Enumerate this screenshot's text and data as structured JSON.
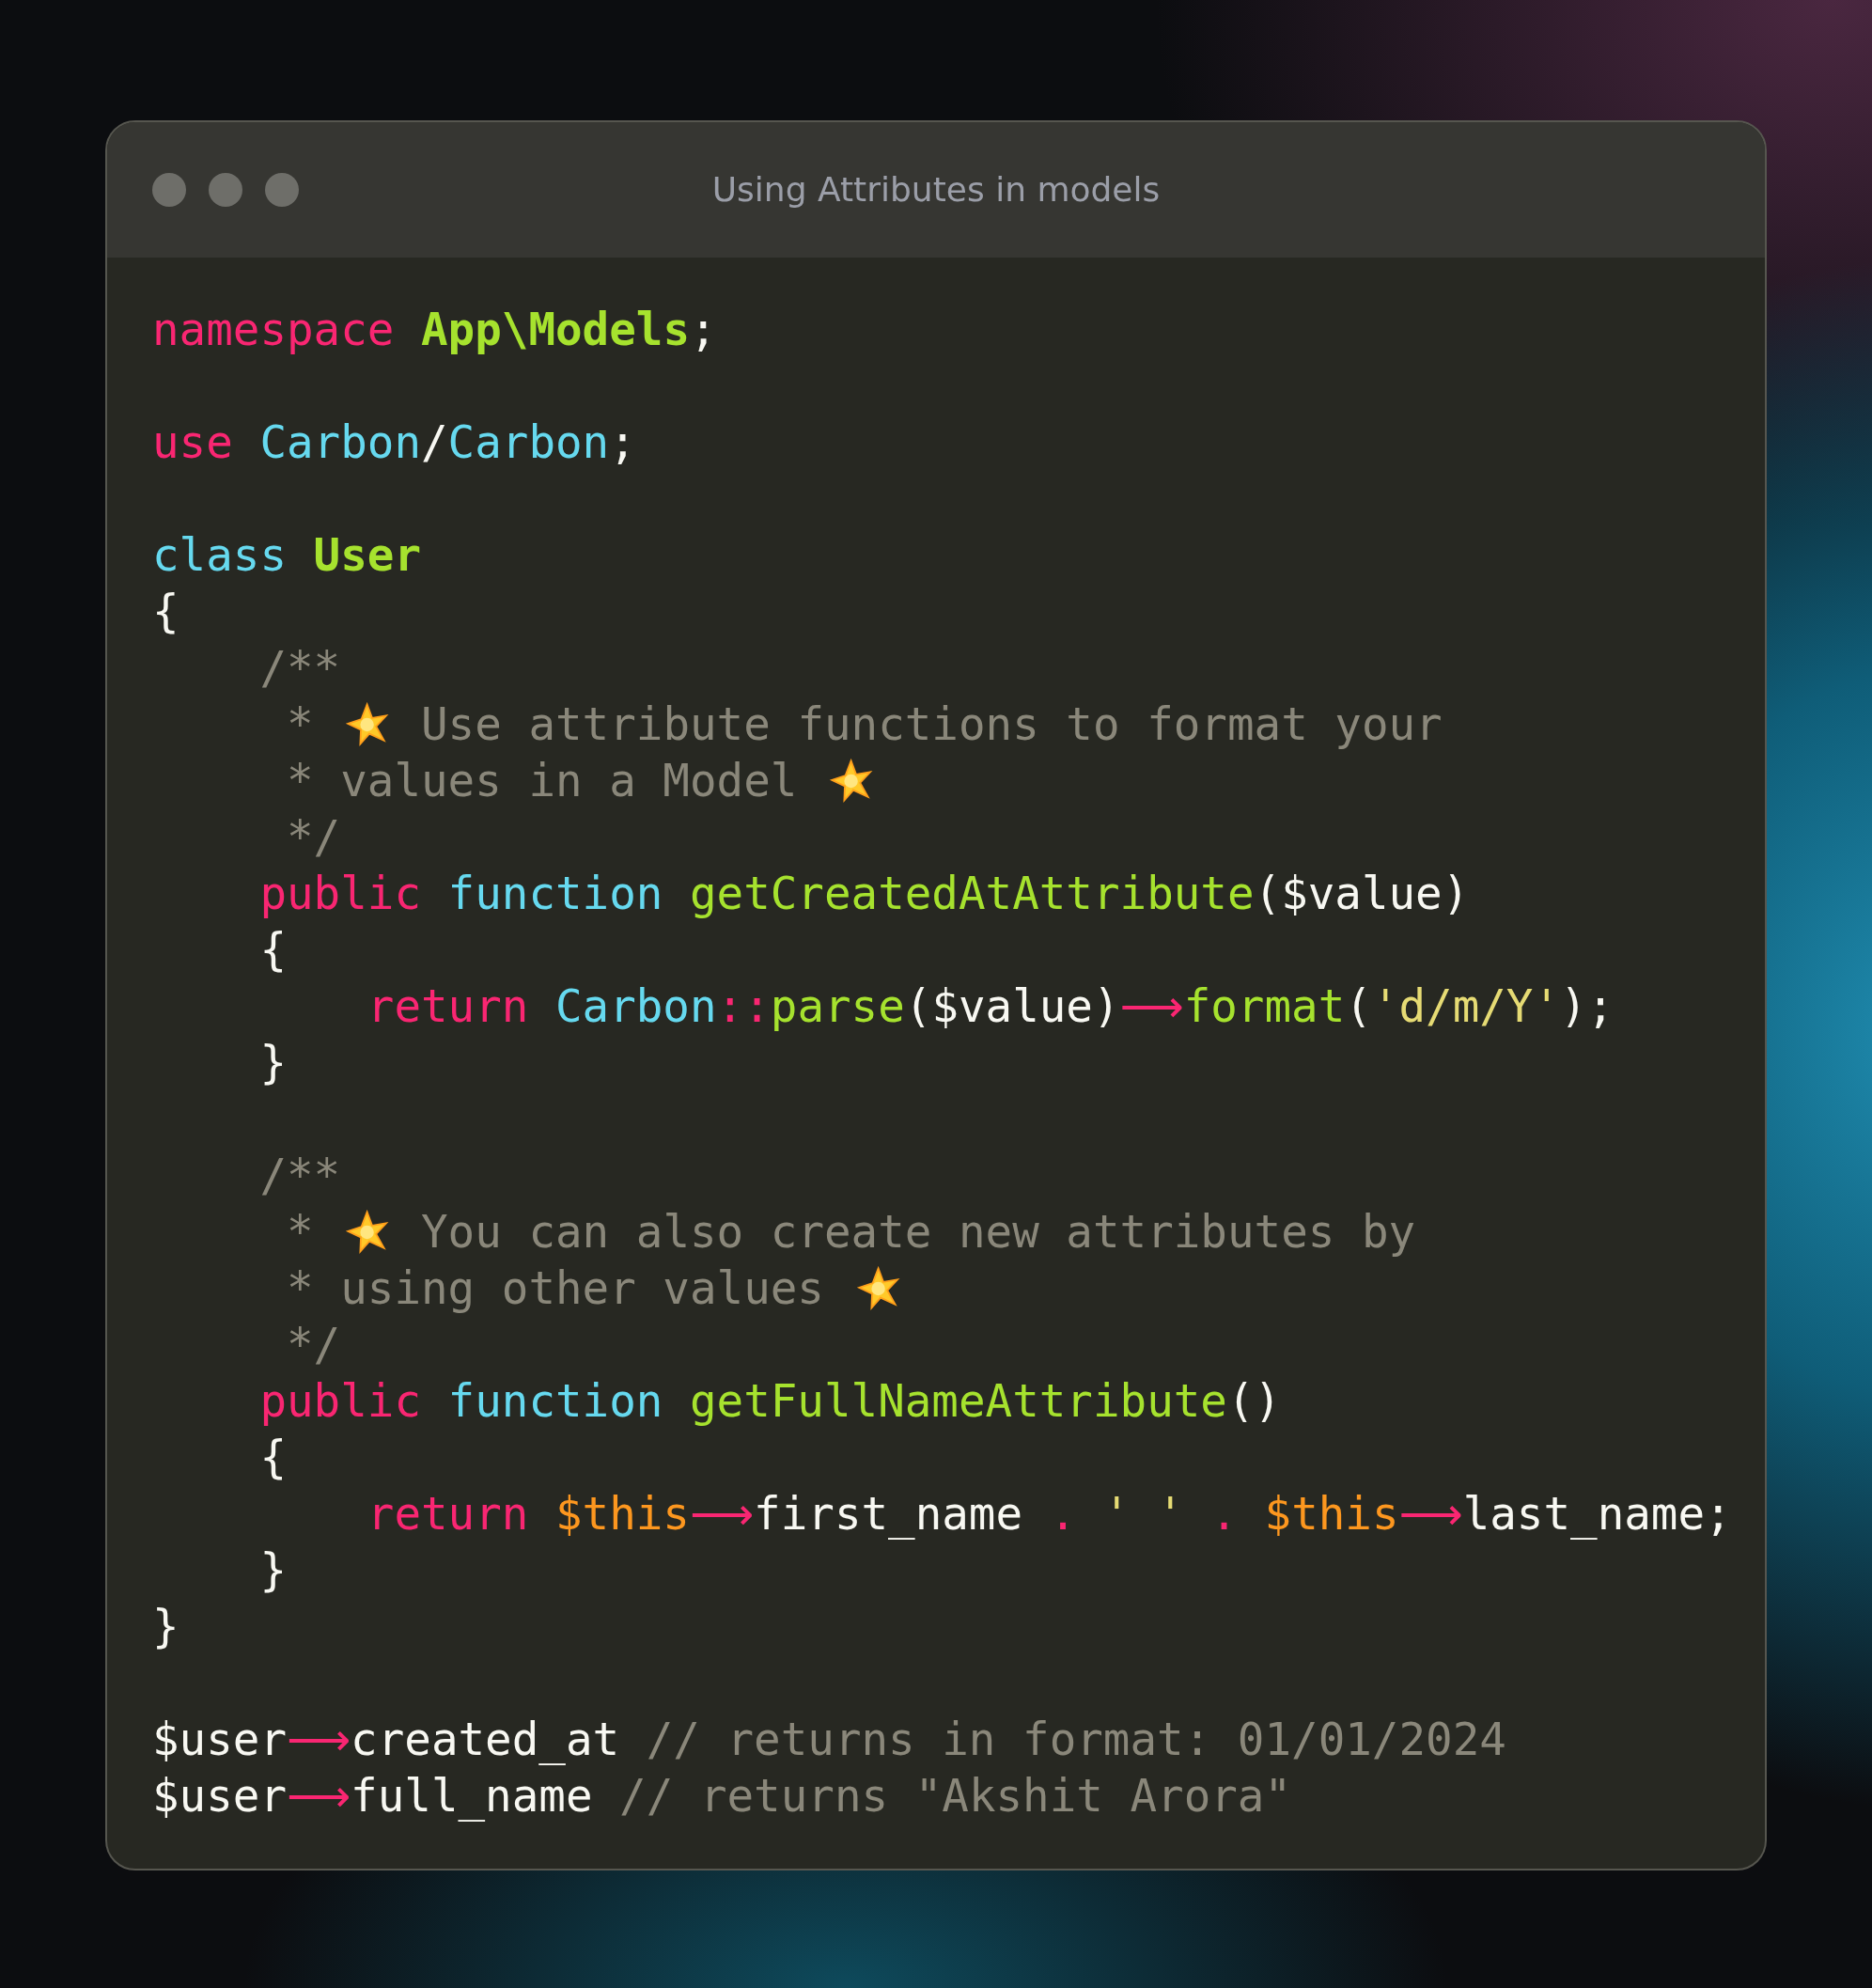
{
  "window": {
    "title": "Using Attributes in models"
  },
  "code": {
    "lines": [
      {
        "kind": "code",
        "tokens": [
          {
            "kind": "keyword",
            "text": "namespace "
          },
          {
            "kind": "name",
            "text": "App\\Models"
          },
          {
            "kind": "plain",
            "text": ";"
          }
        ]
      },
      {
        "kind": "blank"
      },
      {
        "kind": "code",
        "tokens": [
          {
            "kind": "keyword",
            "text": "use "
          },
          {
            "kind": "type",
            "text": "Carbon"
          },
          {
            "kind": "plain",
            "text": "/"
          },
          {
            "kind": "type",
            "text": "Carbon"
          },
          {
            "kind": "plain",
            "text": ";"
          }
        ]
      },
      {
        "kind": "blank"
      },
      {
        "kind": "code",
        "tokens": [
          {
            "kind": "type",
            "text": "class "
          },
          {
            "kind": "name",
            "text": "User"
          }
        ]
      },
      {
        "kind": "code",
        "tokens": [
          {
            "kind": "plain",
            "text": "{"
          }
        ]
      },
      {
        "kind": "code",
        "tokens": [
          {
            "kind": "comment",
            "text": "    /**"
          }
        ]
      },
      {
        "kind": "code",
        "tokens": [
          {
            "kind": "comment",
            "text": "     * "
          },
          {
            "kind": "star"
          },
          {
            "kind": "comment",
            "text": " Use attribute functions to format your"
          }
        ]
      },
      {
        "kind": "code",
        "tokens": [
          {
            "kind": "comment",
            "text": "     * values in a Model "
          },
          {
            "kind": "star"
          }
        ]
      },
      {
        "kind": "code",
        "tokens": [
          {
            "kind": "comment",
            "text": "     */"
          }
        ]
      },
      {
        "kind": "code",
        "tokens": [
          {
            "kind": "keyword",
            "text": "    public "
          },
          {
            "kind": "type",
            "text": "function "
          },
          {
            "kind": "func",
            "text": "getCreatedAtAttribute"
          },
          {
            "kind": "plain",
            "text": "($value)"
          }
        ]
      },
      {
        "kind": "code",
        "tokens": [
          {
            "kind": "plain",
            "text": "    {"
          }
        ]
      },
      {
        "kind": "code",
        "tokens": [
          {
            "kind": "keyword",
            "text": "        return "
          },
          {
            "kind": "type",
            "text": "Carbon"
          },
          {
            "kind": "operator",
            "text": "::"
          },
          {
            "kind": "func",
            "text": "parse"
          },
          {
            "kind": "plain",
            "text": "($value)"
          },
          {
            "kind": "arrow",
            "text": "⟶"
          },
          {
            "kind": "func",
            "text": "format"
          },
          {
            "kind": "plain",
            "text": "("
          },
          {
            "kind": "string",
            "text": "'d/m/Y'"
          },
          {
            "kind": "plain",
            "text": ");"
          }
        ]
      },
      {
        "kind": "code",
        "tokens": [
          {
            "kind": "plain",
            "text": "    }"
          }
        ]
      },
      {
        "kind": "blank"
      },
      {
        "kind": "code",
        "tokens": [
          {
            "kind": "comment",
            "text": "    /**"
          }
        ]
      },
      {
        "kind": "code",
        "tokens": [
          {
            "kind": "comment",
            "text": "     * "
          },
          {
            "kind": "star"
          },
          {
            "kind": "comment",
            "text": " You can also create new attributes by"
          }
        ]
      },
      {
        "kind": "code",
        "tokens": [
          {
            "kind": "comment",
            "text": "     * using other values "
          },
          {
            "kind": "star"
          }
        ]
      },
      {
        "kind": "code",
        "tokens": [
          {
            "kind": "comment",
            "text": "     */"
          }
        ]
      },
      {
        "kind": "code",
        "tokens": [
          {
            "kind": "keyword",
            "text": "    public "
          },
          {
            "kind": "type",
            "text": "function "
          },
          {
            "kind": "func",
            "text": "getFullNameAttribute"
          },
          {
            "kind": "plain",
            "text": "()"
          }
        ]
      },
      {
        "kind": "code",
        "tokens": [
          {
            "kind": "plain",
            "text": "    {"
          }
        ]
      },
      {
        "kind": "code",
        "tokens": [
          {
            "kind": "keyword",
            "text": "        return "
          },
          {
            "kind": "variable",
            "text": "$this"
          },
          {
            "kind": "arrow",
            "text": "⟶"
          },
          {
            "kind": "plain",
            "text": "first_name "
          },
          {
            "kind": "operator",
            "text": ". "
          },
          {
            "kind": "string",
            "text": "' ' "
          },
          {
            "kind": "operator",
            "text": ". "
          },
          {
            "kind": "variable",
            "text": "$this"
          },
          {
            "kind": "arrow",
            "text": "⟶"
          },
          {
            "kind": "plain",
            "text": "last_name;"
          }
        ]
      },
      {
        "kind": "code",
        "tokens": [
          {
            "kind": "plain",
            "text": "    }"
          }
        ]
      },
      {
        "kind": "code",
        "tokens": [
          {
            "kind": "plain",
            "text": "}"
          }
        ]
      },
      {
        "kind": "blank"
      },
      {
        "kind": "code",
        "tokens": [
          {
            "kind": "plain",
            "text": "$user"
          },
          {
            "kind": "arrow",
            "text": "⟶"
          },
          {
            "kind": "plain",
            "text": "created_at "
          },
          {
            "kind": "comment",
            "text": "// returns in format: 01/01/2024"
          }
        ]
      },
      {
        "kind": "code",
        "tokens": [
          {
            "kind": "plain",
            "text": "$user"
          },
          {
            "kind": "arrow",
            "text": "⟶"
          },
          {
            "kind": "plain",
            "text": "full_name "
          },
          {
            "kind": "comment",
            "text": "// returns \"Akshit Arora\""
          }
        ]
      }
    ]
  }
}
